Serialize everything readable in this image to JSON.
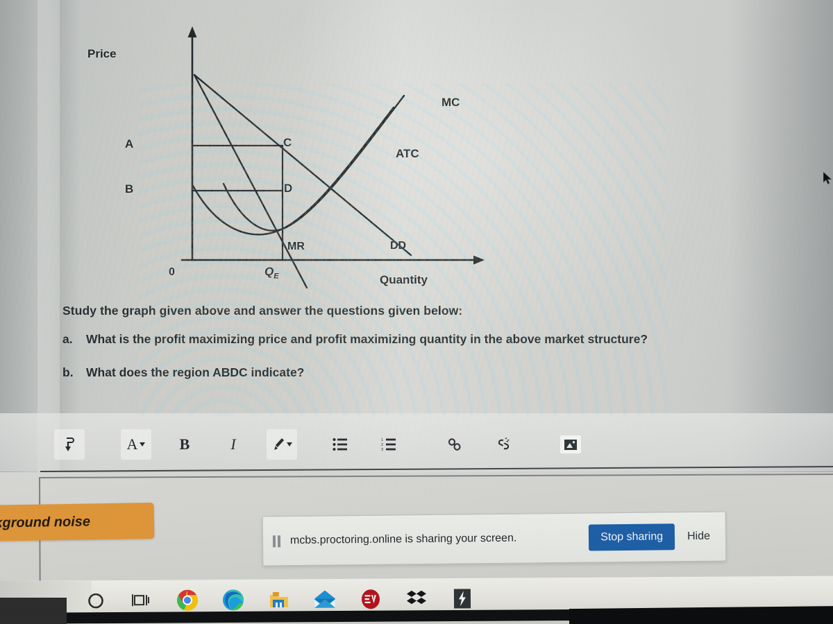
{
  "graph": {
    "y_axis_label": "Price",
    "x_axis_label": "Quantity",
    "origin_label": "0",
    "quantity_point_label": "Q",
    "quantity_point_subscript": "E",
    "curve_labels": {
      "mc": "MC",
      "atc": "ATC",
      "dd": "DD",
      "mr": "MR"
    },
    "region_points": {
      "a": "A",
      "b": "B",
      "c": "C",
      "d": "D"
    }
  },
  "chart_data": {
    "type": "line",
    "title": "",
    "xlabel": "Quantity",
    "ylabel": "Price",
    "grid": false,
    "legend": "inline-curve-labels",
    "annotations": [
      "A",
      "B",
      "C",
      "D",
      "0",
      "QE"
    ],
    "series": [
      {
        "name": "DD",
        "note": "downward sloping demand curve from price axis intercept to the right"
      },
      {
        "name": "MR",
        "note": "marginal revenue, steeper downward line, twice the slope of DD"
      },
      {
        "name": "MC",
        "note": "marginal cost, U-shaped then rising steeply to the upper right"
      },
      {
        "name": "ATC",
        "note": "average total cost, U-shaped lying above MC minimum and rising"
      }
    ],
    "shaded_region": "ABDC rectangle between price A and average cost B at quantity QE"
  },
  "question": {
    "intro": "Study the graph given above and answer the questions given below:",
    "items": [
      {
        "marker": "a.",
        "text": "What is the profit maximizing price and profit maximizing quantity in the above market structure?"
      },
      {
        "marker": "b.",
        "text": "What does the region ABDC indicate?"
      }
    ]
  },
  "toolbar": {
    "items": [
      {
        "name": "undo-arrow",
        "label": "⤵"
      },
      {
        "name": "font-color",
        "label": "A"
      },
      {
        "name": "bold",
        "label": "B"
      },
      {
        "name": "italic",
        "label": "I"
      },
      {
        "name": "highlight-brush",
        "label": "✎"
      },
      {
        "name": "bullet-list",
        "label": "☰"
      },
      {
        "name": "numbered-list",
        "label": "☷"
      },
      {
        "name": "insert-link",
        "label": "ὑ7"
      },
      {
        "name": "remove-link",
        "label": "S"
      },
      {
        "name": "insert-image",
        "label": "ὛB"
      }
    ]
  },
  "notification": {
    "background_noise_badge": "ackground noise",
    "share_message": "mcbs.proctoring.online is sharing your screen.",
    "stop_button": "Stop sharing",
    "hide_link": "Hide"
  },
  "taskbar": {
    "items": [
      {
        "name": "cortana-icon"
      },
      {
        "name": "task-view-icon"
      },
      {
        "name": "google-chrome-icon"
      },
      {
        "name": "microsoft-edge-icon"
      },
      {
        "name": "file-explorer-icon"
      },
      {
        "name": "mail-icon"
      },
      {
        "name": "expressvpn-icon",
        "label": "EV"
      },
      {
        "name": "dropbox-icon"
      },
      {
        "name": "shazam-icon"
      }
    ]
  },
  "colors": {
    "accent_blue": "#1d5fa6",
    "badge_orange": "#e09639",
    "ink": "#1f2629"
  }
}
